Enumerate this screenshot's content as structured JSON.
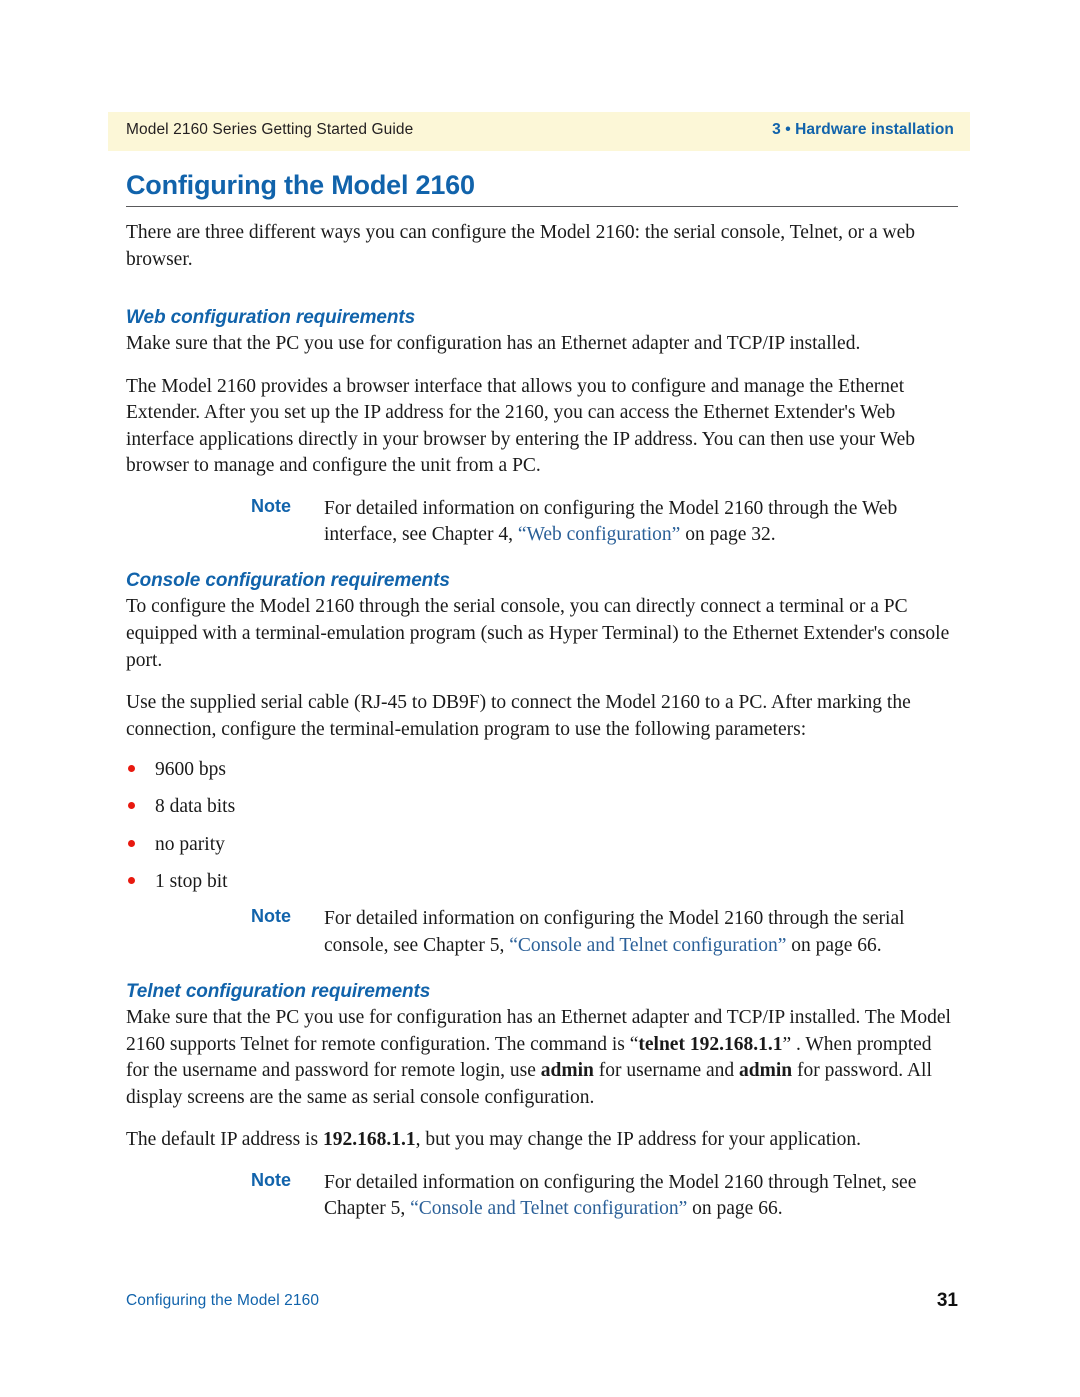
{
  "header": {
    "left_text": "Model 2160 Series Getting Started Guide",
    "right_text": "3 • Hardware installation",
    "band_color": "#fcf7d7",
    "accent_color": "#1163ab"
  },
  "title": "Configuring the Model 2160",
  "intro": "There are three different ways you can configure the Model 2160: the serial console, Telnet, or a web browser.",
  "sections": [
    {
      "heading": "Web configuration requirements",
      "paragraph_1": "Make sure that the PC you use for configuration has an Ethernet adapter and TCP/IP installed.",
      "paragraph_2": "The Model 2160 provides a browser interface that allows you to configure and manage the Ethernet Extender. After you set up the IP address for the 2160, you can access the Ethernet Extender's Web interface applications directly in your browser by entering the IP address. You can then use your Web browser to manage and configure the unit from a PC.",
      "note": {
        "label": "Note",
        "text_before": "For detailed information on configuring the Model 2160 through the Web interface, see Chapter 4, ",
        "xref": "“Web configuration”",
        "text_after": " on page 32."
      }
    },
    {
      "heading": "Console configuration requirements",
      "paragraph_1": "To configure the Model 2160 through the serial console, you can directly connect a terminal or a PC equipped with a terminal-emulation program (such as Hyper Terminal) to the Ethernet Extender's console port.",
      "paragraph_2": "Use the supplied serial cable (RJ-45 to DB9F) to connect the Model 2160 to a PC. After marking the connection, configure the terminal-emulation program to use the following parameters:",
      "parameters": [
        "9600 bps",
        "8 data bits",
        "no parity",
        "1 stop bit"
      ],
      "bullet_color": "#e8190f",
      "note": {
        "label": "Note",
        "text_before": "For detailed information on configuring the Model 2160 through the serial console, see Chapter 5, ",
        "xref": "“Console and Telnet configuration”",
        "text_after": " on page 66."
      }
    },
    {
      "heading": "Telnet configuration requirements",
      "paragraph_1_a": "Make sure that the PC you use for configuration has an Ethernet adapter and TCP/IP installed. The Model 2160 supports Telnet for remote configuration. The command is “",
      "paragraph_1_cmd": "telnet 192.168.1.1",
      "paragraph_1_b": "” .  When prompted for the username and password for remote login, use ",
      "paragraph_1_user": "admin",
      "paragraph_1_c": " for username and ",
      "paragraph_1_pass": "admin",
      "paragraph_1_d": " for password. All display screens are the same as serial console configuration.",
      "paragraph_2_a": "The default IP address is ",
      "paragraph_2_ip": "192.168.1.1",
      "paragraph_2_b": ", but you may change the IP address for your application.",
      "note": {
        "label": "Note",
        "text_before": "For detailed information on configuring the Model 2160 through Telnet, see Chapter 5, ",
        "xref": "“Console and Telnet configuration”",
        "text_after": " on page 66."
      }
    }
  ],
  "footer": {
    "left_text": "Configuring the Model 2160",
    "page_number": "31"
  }
}
